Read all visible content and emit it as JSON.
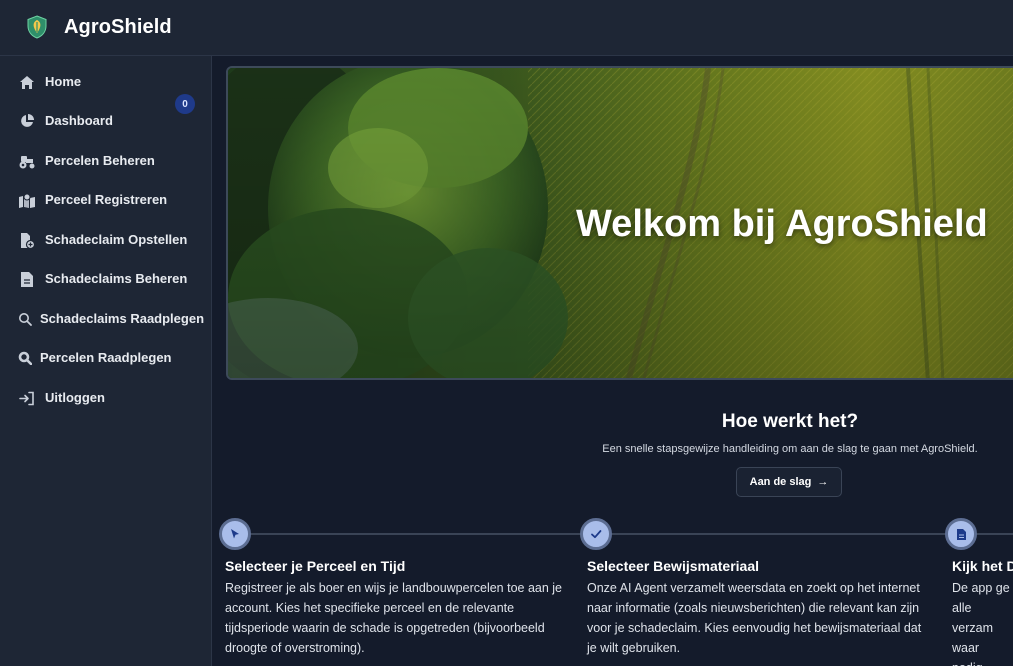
{
  "header": {
    "title": "AgroShield",
    "logo": "shield-leaf-icon"
  },
  "sidebar": {
    "items": [
      {
        "label": "Home",
        "icon": "home-icon"
      },
      {
        "label": "Dashboard",
        "icon": "pie-chart-icon"
      },
      {
        "label": "Percelen Beheren",
        "icon": "tractor-icon",
        "badge": "0"
      },
      {
        "label": "Perceel Registreren",
        "icon": "map-location-icon"
      },
      {
        "label": "Schadeclaim Opstellen",
        "icon": "file-plus-icon"
      },
      {
        "label": "Schadeclaims Beheren",
        "icon": "file-icon"
      },
      {
        "label": "Schadeclaims Raadplegen",
        "icon": "search-icon"
      },
      {
        "label": "Percelen Raadplegen",
        "icon": "search-bold-icon"
      },
      {
        "label": "Uitloggen",
        "icon": "logout-icon"
      }
    ]
  },
  "hero": {
    "title": "Welkom bij AgroShield"
  },
  "how": {
    "title": "Hoe werkt het?",
    "subtitle": "Een snelle stapsgewijze handleiding om aan de slag te gaan met AgroShield.",
    "button_label": "Aan de slag",
    "button_arrow": "→"
  },
  "steps": [
    {
      "title": "Selecteer je Perceel en Tijd",
      "description": "Registreer je als boer en wijs je landbouwpercelen toe aan je account. Kies het specifieke perceel en de relevante tijdsperiode waarin de schade is opgetreden (bijvoorbeeld droogte of overstroming).",
      "icon": "cursor-icon"
    },
    {
      "title": "Selecteer Bewijsmateriaal",
      "description": "Onze AI Agent verzamelt weersdata en zoekt op het internet naar informatie (zoals nieuwsberichten) die relevant kan zijn voor je schadeclaim. Kies eenvoudig het bewijsmateriaal dat je wilt gebruiken.",
      "icon": "check-icon"
    },
    {
      "title": "Kijk het D",
      "description": "De app ge alle verzam waar nodig verzekeraa",
      "icon": "document-icon"
    }
  ],
  "colors": {
    "background": "#141b2b",
    "panel": "#1e2635",
    "badge": "#1f3a8a",
    "step_circle": "#a9bdea"
  }
}
